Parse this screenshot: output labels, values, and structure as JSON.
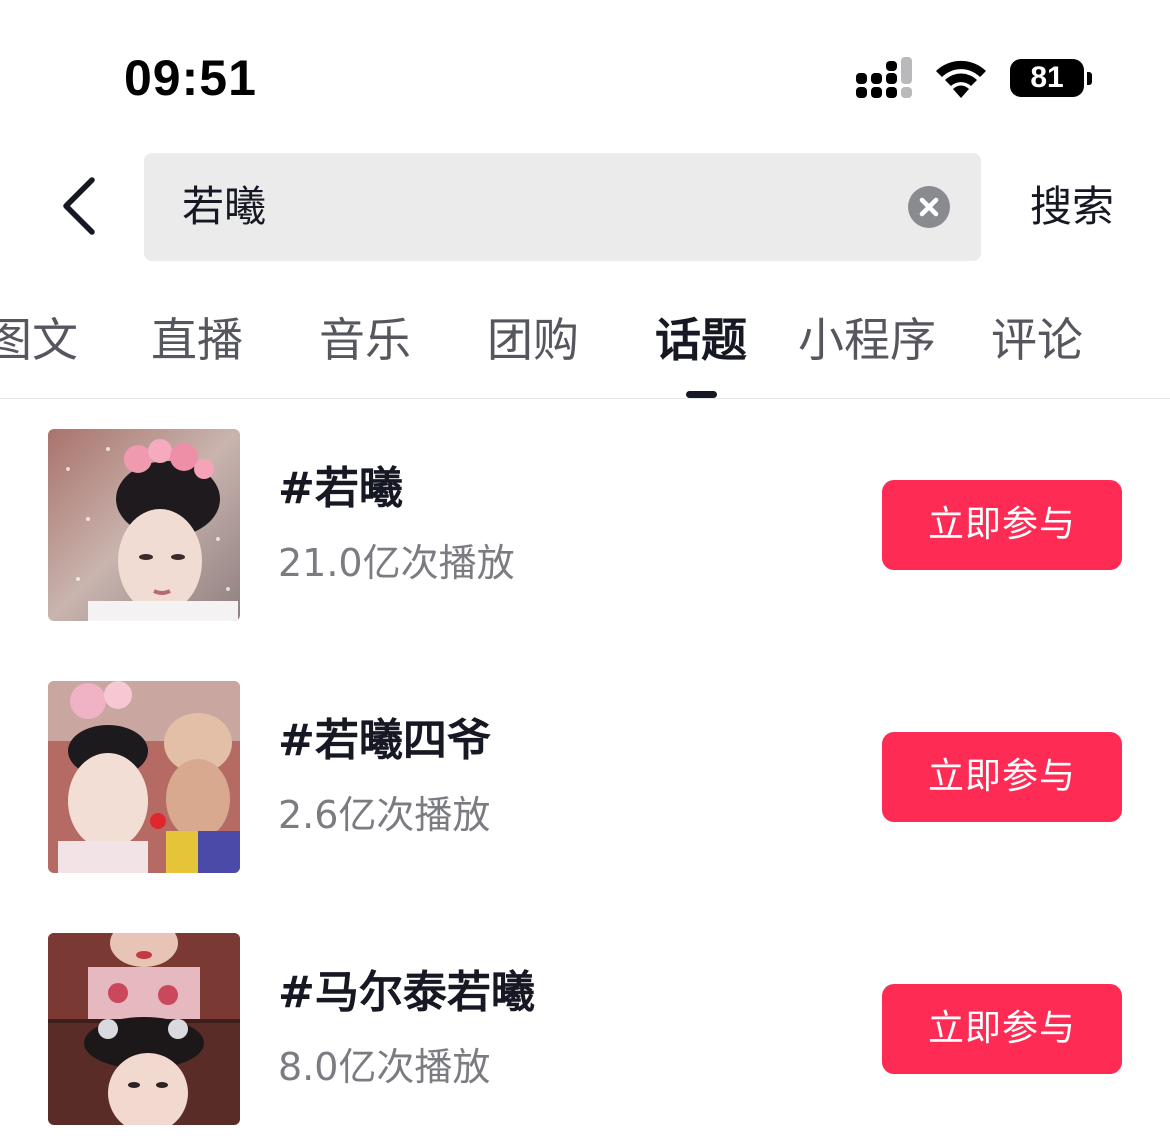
{
  "status_bar": {
    "time": "09:51",
    "battery": "81",
    "icons": [
      "cellular-signal-icon",
      "wifi-icon",
      "battery-icon"
    ]
  },
  "header": {
    "back_icon": "chevron-left-icon",
    "search_query": "若曦",
    "clear_icon": "clear-circle-icon",
    "search_button": "搜索"
  },
  "tabs": [
    {
      "label": "图文",
      "active": false
    },
    {
      "label": "直播",
      "active": false
    },
    {
      "label": "音乐",
      "active": false
    },
    {
      "label": "团购",
      "active": false
    },
    {
      "label": "话题",
      "active": true
    },
    {
      "label": "小程序",
      "active": false
    },
    {
      "label": "评论",
      "active": false
    }
  ],
  "topics": [
    {
      "title": "#若曦",
      "plays": "21.0亿次播放",
      "button": "立即参与"
    },
    {
      "title": "#若曦四爷",
      "plays": "2.6亿次播放",
      "button": "立即参与"
    },
    {
      "title": "#马尔泰若曦",
      "plays": "8.0亿次播放",
      "button": "立即参与"
    }
  ],
  "colors": {
    "accent": "#fe2c55",
    "text_primary": "#161823",
    "text_secondary": "#7b7c82",
    "search_bg": "#ebebeb"
  }
}
